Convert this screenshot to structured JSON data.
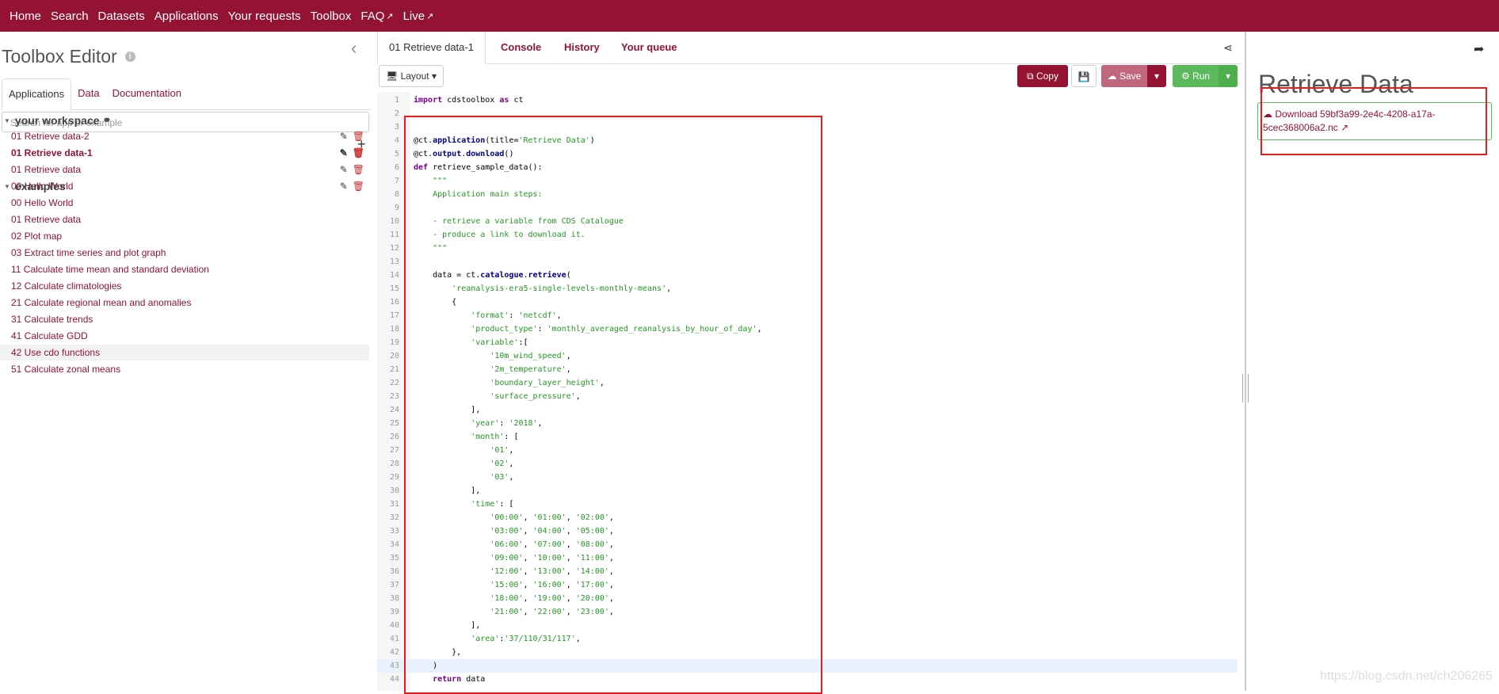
{
  "nav": [
    {
      "label": "Home",
      "external": false
    },
    {
      "label": "Search",
      "external": false
    },
    {
      "label": "Datasets",
      "external": false
    },
    {
      "label": "Applications",
      "external": false
    },
    {
      "label": "Your requests",
      "external": false
    },
    {
      "label": "Toolbox",
      "external": false
    },
    {
      "label": "FAQ",
      "external": true
    },
    {
      "label": "Live",
      "external": true
    }
  ],
  "left": {
    "title": "Toolbox Editor",
    "tabs": [
      "Applications",
      "Data",
      "Documentation"
    ],
    "search_placeholder": "Search for app or example",
    "workspace_label": "your workspace",
    "workspace_items": [
      "01 Retrieve data-2",
      "01 Retrieve data-1",
      "01 Retrieve data",
      "00 Hello World"
    ],
    "examples_label": "examples",
    "examples": [
      "00 Hello World",
      "01 Retrieve data",
      "02 Plot map",
      "03 Extract time series and plot graph",
      "11 Calculate time mean and standard deviation",
      "12 Calculate climatologies",
      "21 Calculate regional mean and anomalies",
      "31 Calculate trends",
      "41 Calculate GDD",
      "42 Use cdo functions",
      "51 Calculate zonal means"
    ]
  },
  "mid": {
    "tabs": [
      "01 Retrieve data-1",
      "Console",
      "History",
      "Your queue"
    ],
    "layout_label": "Layout",
    "copy_label": "Copy",
    "save_label": "Save",
    "run_label": "Run"
  },
  "code": [
    "import cdstoolbox as ct",
    "",
    "",
    "@ct.application(title='Retrieve Data')",
    "@ct.output.download()",
    "def retrieve_sample_data():",
    "    \"\"\"",
    "    Application main steps:",
    "",
    "    - retrieve a variable from CDS Catalogue",
    "    - produce a link to download it.",
    "    \"\"\"",
    "",
    "    data = ct.catalogue.retrieve(",
    "        'reanalysis-era5-single-levels-monthly-means',",
    "        {",
    "            'format': 'netcdf',",
    "            'product_type': 'monthly_averaged_reanalysis_by_hour_of_day',",
    "            'variable':[",
    "                '10m_wind_speed',",
    "                '2m_temperature',",
    "                'boundary_layer_height',",
    "                'surface_pressure',",
    "            ],",
    "            'year': '2018',",
    "            'month': [",
    "                '01',",
    "                '02',",
    "                '03',",
    "            ],",
    "            'time': [",
    "                '00:00', '01:00', '02:00',",
    "                '03:00', '04:00', '05:00',",
    "                '06:00', '07:00', '08:00',",
    "                '09:00', '10:00', '11:00',",
    "                '12:00', '13:00', '14:00',",
    "                '15:00', '16:00', '17:00',",
    "                '18:00', '19:00', '20:00',",
    "                '21:00', '22:00', '23:00',",
    "            ],",
    "            'area':'37/110/31/117',",
    "        },",
    "    )",
    "    return data"
  ],
  "right": {
    "title": "Retrieve Data",
    "download_text": "Download 59bf3a99-2e4c-4208-a17a-5cec368006a2.nc"
  },
  "watermark": "https://blog.csdn.net/ch206265",
  "colors": {
    "brand": "#941333",
    "success": "#5cb85c",
    "annotation": "#e31c1c"
  }
}
